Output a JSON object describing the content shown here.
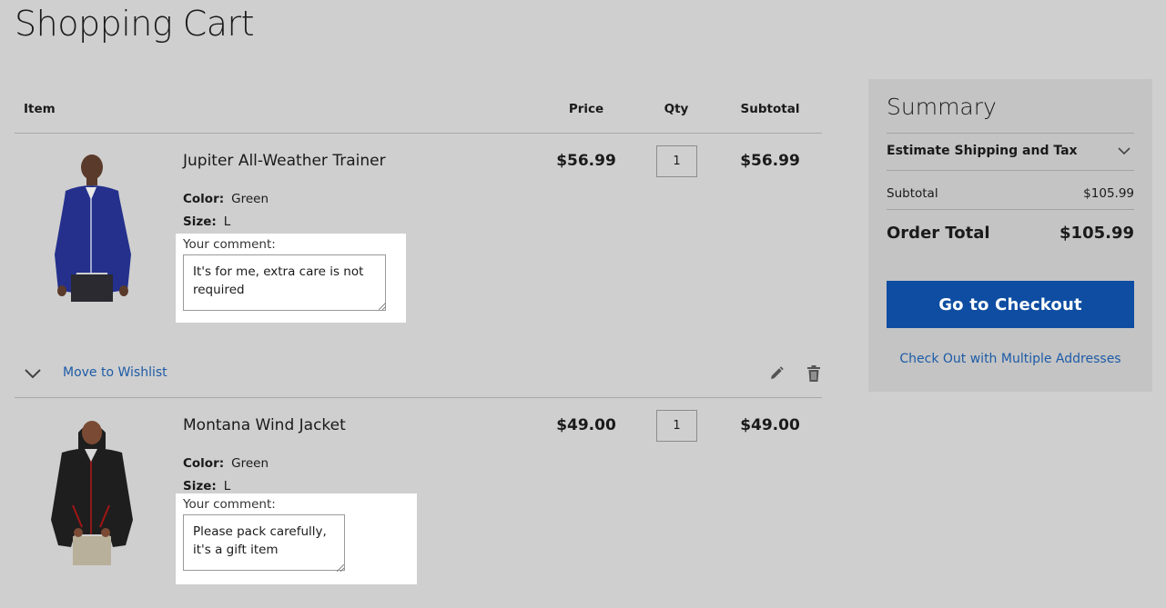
{
  "page": {
    "title": "Shopping Cart"
  },
  "table": {
    "headers": {
      "item": "Item",
      "price": "Price",
      "qty": "Qty",
      "subtotal": "Subtotal"
    }
  },
  "items": [
    {
      "name": "Jupiter All-Weather Trainer",
      "color_label": "Color:",
      "color": "Green",
      "size_label": "Size:",
      "size": "L",
      "comment_label": "Your comment:",
      "comment": "It's for me, extra care is not required",
      "price": "$56.99",
      "qty": "1",
      "subtotal": "$56.99",
      "image_color": "#24308c"
    },
    {
      "name": "Montana Wind Jacket",
      "color_label": "Color:",
      "color": "Green",
      "size_label": "Size:",
      "size": "L",
      "comment_label": "Your comment:",
      "comment": "Please pack carefully, it's a gift item",
      "price": "$49.00",
      "qty": "1",
      "subtotal": "$49.00",
      "image_color": "#1e1e1e"
    }
  ],
  "actions": {
    "move_to_wishlist": "Move to Wishlist"
  },
  "summary": {
    "title": "Summary",
    "estimate_shipping": "Estimate Shipping and Tax",
    "subtotal_label": "Subtotal",
    "subtotal_value": "$105.99",
    "order_total_label": "Order Total",
    "order_total_value": "$105.99",
    "checkout_button": "Go to Checkout",
    "multi_address_link": "Check Out with Multiple Addresses"
  },
  "colors": {
    "background": "#cfcfcf",
    "summary_bg": "#c4c4c4",
    "primary_button": "#0e4da1",
    "link": "#1d5ba7"
  }
}
